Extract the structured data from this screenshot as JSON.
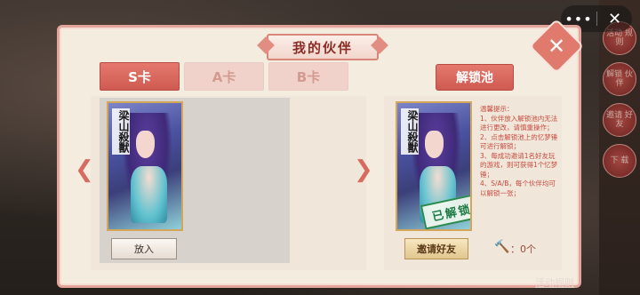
{
  "page_title": "我的伙伴",
  "tabs": [
    {
      "label": "S卡",
      "active": true
    },
    {
      "label": "A卡",
      "active": false
    },
    {
      "label": "B卡",
      "active": false
    }
  ],
  "unlock_pool_label": "解锁池",
  "left_card": {
    "name": "梁山殺獸"
  },
  "right_card": {
    "name": "梁山殺獸",
    "stamp": "已解锁"
  },
  "place_button": "放入",
  "invite_button": "邀请好友",
  "hammer_count": "：0个",
  "tips": {
    "heading": "温馨提示：",
    "lines": [
      "1、伙伴放入解锁池内无法进行更改，请慎重操作；",
      "2、点击解锁池上的忆梦锤可进行解锁；",
      "3、每成功邀请1名好友玩的游戏，则可获得1个忆梦锤；",
      "4、S/A/B，每个伙伴均可以解锁一张；"
    ]
  },
  "rules_link": "活动规则",
  "side_buttons": [
    "活动\n规则",
    "解锁\n伙伴",
    "邀请\n好友",
    "下\n载"
  ],
  "colors": {
    "accent": "#d86a5f",
    "panel": "#f4ecdf",
    "border": "#e3a59a"
  },
  "icons": [
    "more-icon",
    "close-icon",
    "arrow-left-icon",
    "arrow-right-icon",
    "hammer-icon",
    "corner-close-icon"
  ]
}
